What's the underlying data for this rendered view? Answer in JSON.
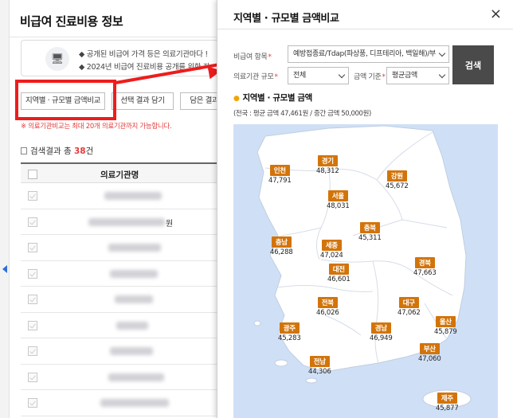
{
  "page": {
    "title": "비급여 진료비용 정보",
    "notice": {
      "line1": "◆ 공개된 비급여 가격 등은 의료기관마다 !",
      "line2": "◆ 2024년 비급여 진료비용 공개를 위한 자"
    },
    "buttons": {
      "region_compare": "지역별 · 규모별 금액비교",
      "select_add": "선택 결과 담기",
      "view_added": "담은 결과 확인"
    },
    "red_note": "※ 의료기관비교는 최대 20개 의료기관까지 가능합니다.",
    "result": {
      "prefix": "검색결과 총 ",
      "count": "38",
      "suffix": "건"
    },
    "table_header": "의료기관명",
    "row_suffix": "원"
  },
  "modal": {
    "title": "지역별 · 규모별 금액비교",
    "close": "×",
    "item_label": "비급여 항목",
    "item_value": "예방접종료/Tdap(파상풍, 디프테리아, 백일해)/부",
    "size_label": "의료기관 규모",
    "size_value": "전체",
    "price_label": "금액 기준",
    "price_value": "평균금액",
    "search": "검색",
    "section_title": "지역별 · 규모별 금액",
    "summary": "(전국 : 평균 금액 47,461원 / 중간 금액 50,000원)"
  },
  "regions": [
    {
      "name": "인천",
      "value": "47,791"
    },
    {
      "name": "경기",
      "value": "48,312"
    },
    {
      "name": "강원",
      "value": "45,672"
    },
    {
      "name": "서울",
      "value": "48,031"
    },
    {
      "name": "충북",
      "value": "45,311"
    },
    {
      "name": "충남",
      "value": "46,288"
    },
    {
      "name": "세종",
      "value": "47,024"
    },
    {
      "name": "대전",
      "value": "46,601"
    },
    {
      "name": "경북",
      "value": "47,663"
    },
    {
      "name": "전북",
      "value": "46,026"
    },
    {
      "name": "대구",
      "value": "47,062"
    },
    {
      "name": "광주",
      "value": "45,283"
    },
    {
      "name": "경남",
      "value": "46,949"
    },
    {
      "name": "울산",
      "value": "45,879"
    },
    {
      "name": "부산",
      "value": "47,060"
    },
    {
      "name": "전남",
      "value": "44,306"
    },
    {
      "name": "제주",
      "value": "45,877"
    }
  ],
  "colors": {
    "tag": "#d2740a",
    "highlight": "#ee1c1c",
    "map_sea": "#cfe0f6",
    "map_land": "#ffffff"
  }
}
